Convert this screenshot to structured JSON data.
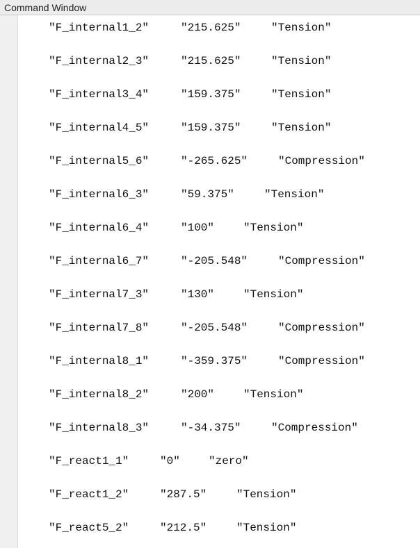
{
  "window": {
    "title": "Command Window"
  },
  "rows": [
    {
      "name": "\"F_internal1_2\"",
      "value": "\"215.625\"",
      "state": "\"Tension\""
    },
    {
      "name": "\"F_internal2_3\"",
      "value": "\"215.625\"",
      "state": "\"Tension\""
    },
    {
      "name": "\"F_internal3_4\"",
      "value": "\"159.375\"",
      "state": "\"Tension\""
    },
    {
      "name": "\"F_internal4_5\"",
      "value": "\"159.375\"",
      "state": "\"Tension\""
    },
    {
      "name": "\"F_internal5_6\"",
      "value": "\"-265.625\"",
      "state": "\"Compression\""
    },
    {
      "name": "\"F_internal6_3\"",
      "value": "\"59.375\"",
      "state": "\"Tension\""
    },
    {
      "name": "\"F_internal6_4\"",
      "value": "\"100\"",
      "state": "\"Tension\""
    },
    {
      "name": "\"F_internal6_7\"",
      "value": "\"-205.548\"",
      "state": "\"Compression\""
    },
    {
      "name": "\"F_internal7_3\"",
      "value": "\"130\"",
      "state": "\"Tension\""
    },
    {
      "name": "\"F_internal7_8\"",
      "value": "\"-205.548\"",
      "state": "\"Compression\""
    },
    {
      "name": "\"F_internal8_1\"",
      "value": "\"-359.375\"",
      "state": "\"Compression\""
    },
    {
      "name": "\"F_internal8_2\"",
      "value": "\"200\"",
      "state": "\"Tension\""
    },
    {
      "name": "\"F_internal8_3\"",
      "value": "\"-34.375\"",
      "state": "\"Compression\""
    },
    {
      "name": "\"F_react1_1\"",
      "value": "\"0\"",
      "state": "\"zero\""
    },
    {
      "name": "\"F_react1_2\"",
      "value": "\"287.5\"",
      "state": "\"Tension\""
    },
    {
      "name": "\"F_react5_2\"",
      "value": "\"212.5\"",
      "state": "\"Tension\""
    }
  ]
}
